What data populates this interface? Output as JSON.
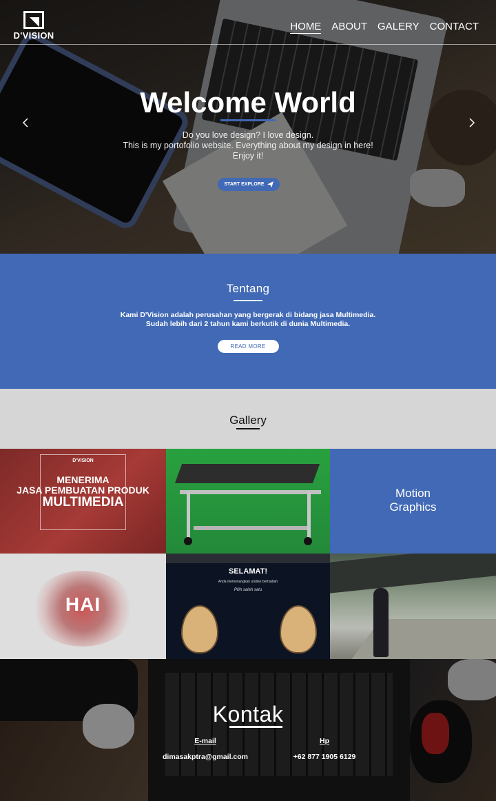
{
  "brand": {
    "name": "D'VISION"
  },
  "nav": {
    "items": [
      "HOME",
      "ABOUT",
      "GALERY",
      "CONTACT"
    ],
    "active": "HOME"
  },
  "hero": {
    "title": "Welcome World",
    "lines": [
      "Do you love design? I love design.",
      "This is my portofolio website. Everything about my design in here!",
      "Enjoy it!"
    ],
    "button": "START EXPLORE",
    "accent_color": "#4169b5"
  },
  "about": {
    "title": "Tentang",
    "lines": [
      "Kami D'Vision adalah perusahan yang bergerak di bidang jasa Multimedia.",
      "Sudah lebih dari 2 tahun kami berkutik di dunia Multimedia."
    ],
    "button": "READ MORE",
    "background": "#4169b5"
  },
  "gallery": {
    "title": "Gallery",
    "tile1": {
      "top": "D'VISION",
      "line1": "MENERIMA",
      "line2": "JASA PEMBUATAN PRODUK",
      "line3": "MULTIMEDIA"
    },
    "tile3": {
      "line1": "Motion",
      "line2": "Graphics"
    },
    "tile4": {
      "text": "HAI"
    },
    "tile5": {
      "title": "SELAMAT!",
      "sub1": "Anda memenangkan undian berhadiah",
      "sub2": "Pilih salah satu"
    }
  },
  "contact": {
    "title": "Kontak",
    "email_label": "E-mail",
    "email": "dimasakptra@gmail.com",
    "phone_label": "Hp",
    "phone": "+62 877 1905 6129"
  }
}
